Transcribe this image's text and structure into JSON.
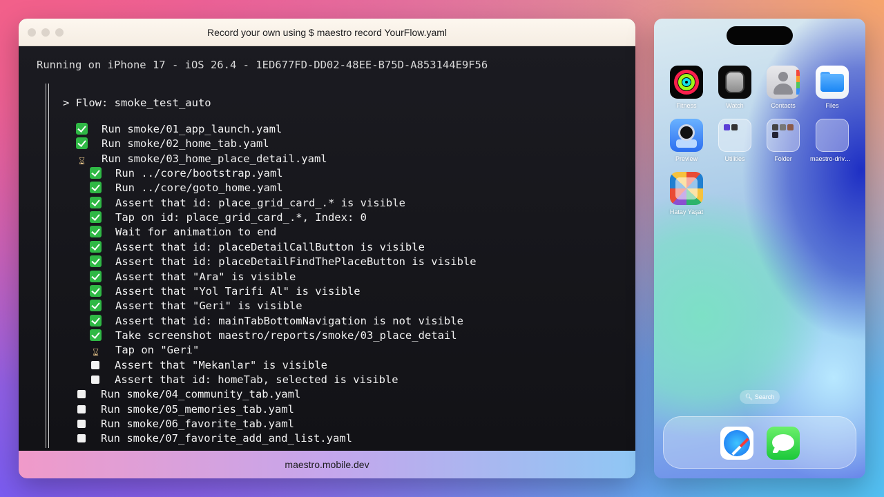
{
  "terminal": {
    "title": "Record your own using $ maestro record YourFlow.yaml",
    "running_line": "Running on iPhone 17 - iOS 26.4 - 1ED677FD-DD02-48EE-B75D-A853144E9F56",
    "flow_label": "> Flow: smoke_test_auto",
    "footer": "maestro.mobile.dev",
    "commands": [
      {
        "status": "done",
        "indent": 0,
        "text": "Run smoke/01_app_launch.yaml"
      },
      {
        "status": "done",
        "indent": 0,
        "text": "Run smoke/02_home_tab.yaml"
      },
      {
        "status": "running",
        "indent": 0,
        "text": "Run smoke/03_home_place_detail.yaml"
      },
      {
        "status": "done",
        "indent": 1,
        "text": "Run ../core/bootstrap.yaml"
      },
      {
        "status": "done",
        "indent": 1,
        "text": "Run ../core/goto_home.yaml"
      },
      {
        "status": "done",
        "indent": 1,
        "text": "Assert that id: place_grid_card_.* is visible"
      },
      {
        "status": "done",
        "indent": 1,
        "text": "Tap on id: place_grid_card_.*, Index: 0"
      },
      {
        "status": "done",
        "indent": 1,
        "text": "Wait for animation to end"
      },
      {
        "status": "done",
        "indent": 1,
        "text": "Assert that id: placeDetailCallButton is visible"
      },
      {
        "status": "done",
        "indent": 1,
        "text": "Assert that id: placeDetailFindThePlaceButton is visible"
      },
      {
        "status": "done",
        "indent": 1,
        "text": "Assert that \"Ara\" is visible"
      },
      {
        "status": "done",
        "indent": 1,
        "text": "Assert that \"Yol Tarifi Al\" is visible"
      },
      {
        "status": "done",
        "indent": 1,
        "text": "Assert that \"Geri\" is visible"
      },
      {
        "status": "done",
        "indent": 1,
        "text": "Assert that id: mainTabBottomNavigation is not visible"
      },
      {
        "status": "done",
        "indent": 1,
        "text": "Take screenshot maestro/reports/smoke/03_place_detail"
      },
      {
        "status": "running",
        "indent": 1,
        "text": "Tap on \"Geri\""
      },
      {
        "status": "pending",
        "indent": 1,
        "text": "Assert that \"Mekanlar\" is visible"
      },
      {
        "status": "pending",
        "indent": 1,
        "text": "Assert that id: homeTab, selected is visible"
      },
      {
        "status": "pending",
        "indent": 0,
        "text": "Run smoke/04_community_tab.yaml"
      },
      {
        "status": "pending",
        "indent": 0,
        "text": "Run smoke/05_memories_tab.yaml"
      },
      {
        "status": "pending",
        "indent": 0,
        "text": "Run smoke/06_favorite_tab.yaml"
      },
      {
        "status": "pending",
        "indent": 0,
        "text": "Run smoke/07_favorite_add_and_list.yaml"
      }
    ]
  },
  "phone": {
    "apps": [
      {
        "label": "Fitness",
        "icon": "fitness-icon"
      },
      {
        "label": "Watch",
        "icon": "watch-icon"
      },
      {
        "label": "Contacts",
        "icon": "contacts-icon"
      },
      {
        "label": "Files",
        "icon": "files-icon"
      },
      {
        "label": "Preview",
        "icon": "preview-icon"
      },
      {
        "label": "Utilities",
        "icon": "utilities-folder-icon"
      },
      {
        "label": "Folder",
        "icon": "folder-icon"
      },
      {
        "label": "maestro-driver-i...",
        "icon": "maestro-driver-icon"
      },
      {
        "label": "Hatay Yaşat",
        "icon": "hatay-app-icon"
      }
    ],
    "search_label": "Search",
    "dock": [
      {
        "label": "Safari",
        "icon": "safari-icon"
      },
      {
        "label": "Messages",
        "icon": "messages-icon"
      }
    ]
  },
  "colors": {
    "terminal_bg": "#17171c",
    "check_green": "#2fb845",
    "text": "#f1f1f1"
  }
}
